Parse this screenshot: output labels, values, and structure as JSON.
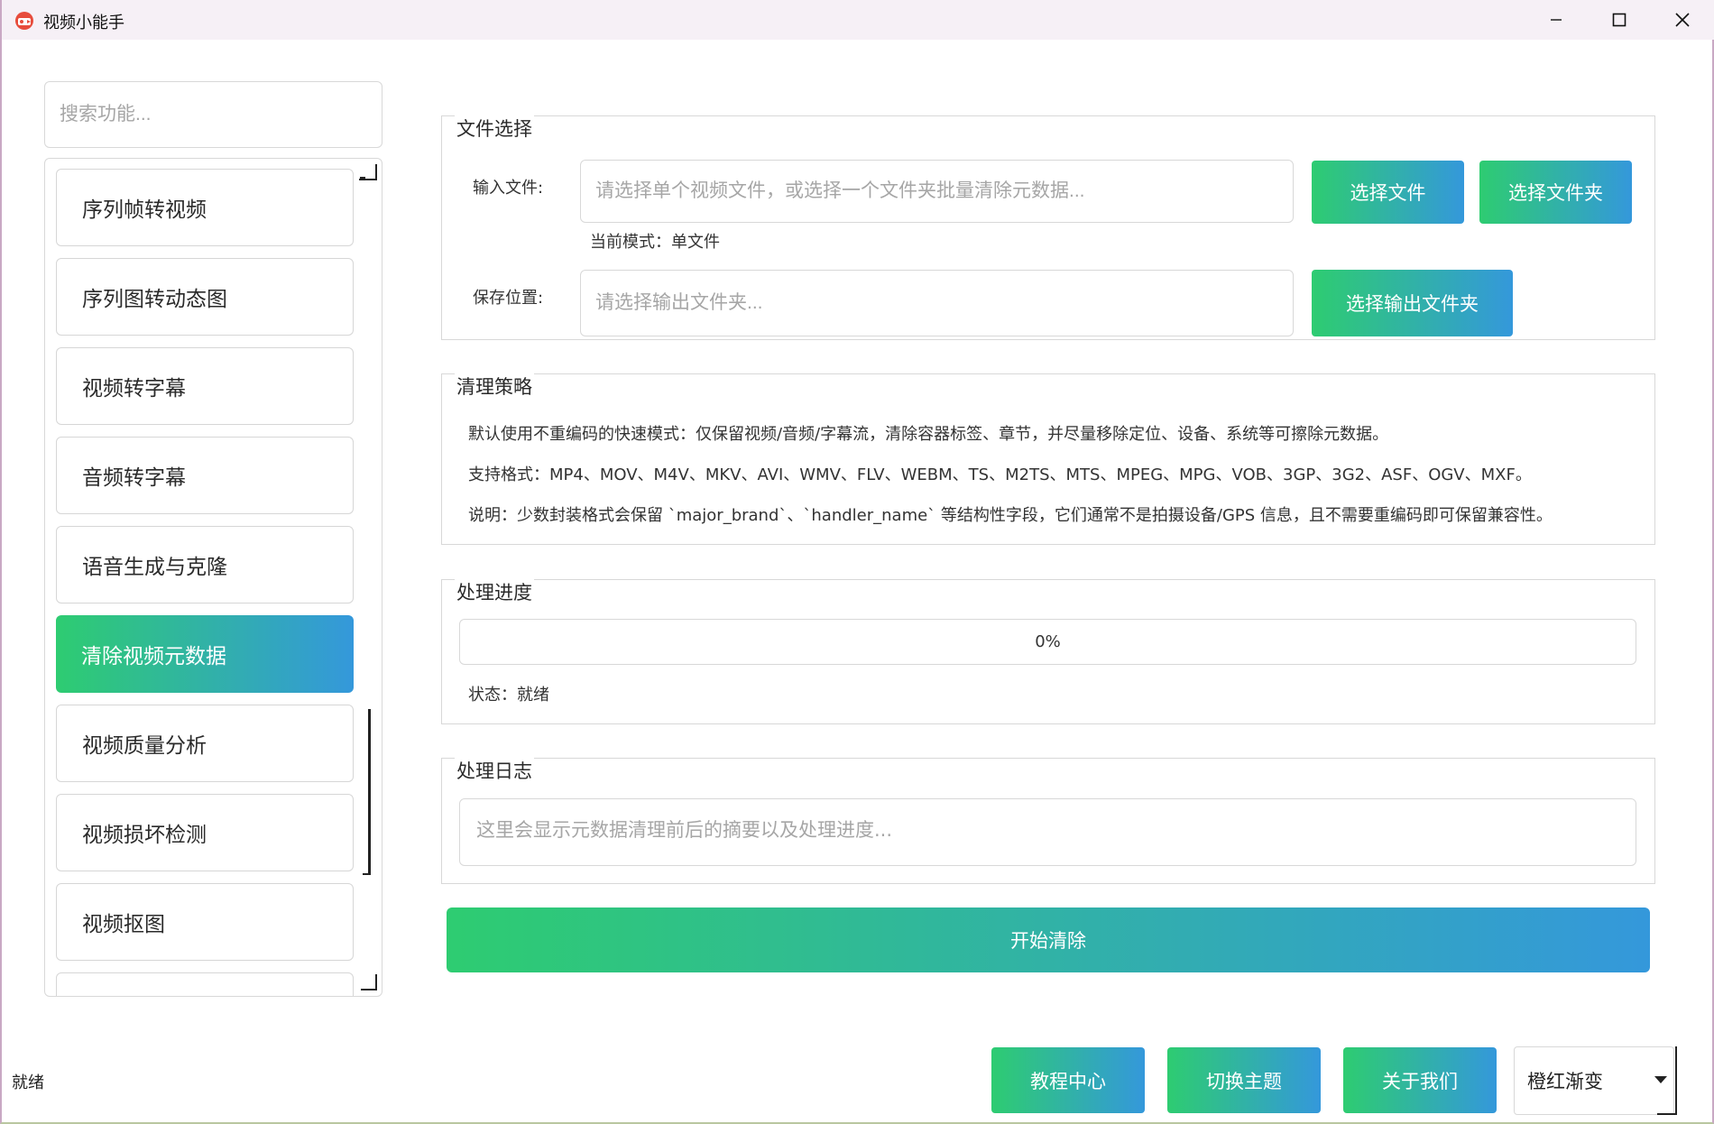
{
  "window": {
    "title": "视频小能手"
  },
  "sidebar": {
    "search_placeholder": "搜索功能...",
    "items": [
      {
        "label": "序列帧转视频"
      },
      {
        "label": "序列图转动态图"
      },
      {
        "label": "视频转字幕"
      },
      {
        "label": "音频转字幕"
      },
      {
        "label": "语音生成与克隆"
      },
      {
        "label": "清除视频元数据",
        "active": true
      },
      {
        "label": "视频质量分析"
      },
      {
        "label": "视频损坏检测"
      },
      {
        "label": "视频抠图"
      }
    ]
  },
  "file_select": {
    "title": "文件选择",
    "input_label": "输入文件:",
    "input_placeholder": "请选择单个视频文件，或选择一个文件夹批量清除元数据...",
    "select_file_btn": "选择文件",
    "select_folder_btn": "选择文件夹",
    "mode_text": "当前模式：单文件",
    "save_label": "保存位置:",
    "save_placeholder": "请选择输出文件夹...",
    "select_output_btn": "选择输出文件夹"
  },
  "strategy": {
    "title": "清理策略",
    "line1": "默认使用不重编码的快速模式：仅保留视频/音频/字幕流，清除容器标签、章节，并尽量移除定位、设备、系统等可擦除元数据。",
    "line2": "支持格式：MP4、MOV、M4V、MKV、AVI、WMV、FLV、WEBM、TS、M2TS、MTS、MPEG、MPG、VOB、3GP、3G2、ASF、OGV、MXF。",
    "line3": "说明：少数封装格式会保留 `major_brand`、`handler_name` 等结构性字段，它们通常不是拍摄设备/GPS 信息，且不需要重编码即可保留兼容性。"
  },
  "progress": {
    "title": "处理进度",
    "value": 0,
    "label": "0%",
    "status": "状态：就绪"
  },
  "log": {
    "title": "处理日志",
    "placeholder": "这里会显示元数据清理前后的摘要以及处理进度..."
  },
  "actions": {
    "start": "开始清除"
  },
  "footer": {
    "status": "就绪",
    "tutorial": "教程中心",
    "switch_theme": "切换主题",
    "about": "关于我们",
    "theme_selected": "橙红渐变"
  },
  "colors": {
    "gradient_start": "#2ecc71",
    "gradient_end": "#3498db"
  },
  "icons": {
    "app": "video-app-icon",
    "minimize": "minimize-icon",
    "maximize": "maximize-icon",
    "close": "close-icon",
    "dropdown": "chevron-down-icon"
  }
}
